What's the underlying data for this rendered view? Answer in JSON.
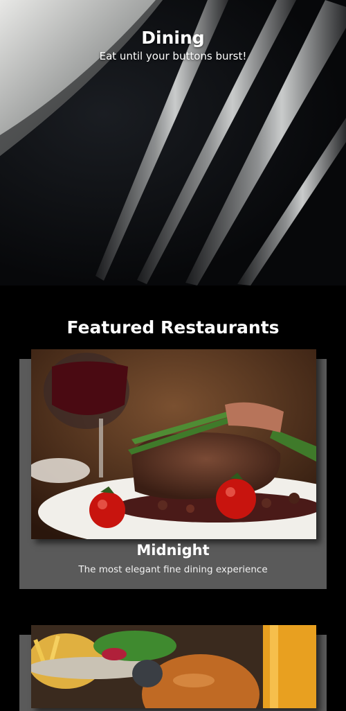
{
  "hero": {
    "title": "Dining",
    "subtitle": "Eat until your buttons burst!"
  },
  "featured": {
    "heading": "Featured Restaurants",
    "restaurants": [
      {
        "name": "Midnight",
        "description": "The most elegant fine dining experience"
      }
    ]
  },
  "colors": {
    "page_background": "#000000",
    "card_background": "#5a5a5a",
    "text": "#ffffff"
  }
}
